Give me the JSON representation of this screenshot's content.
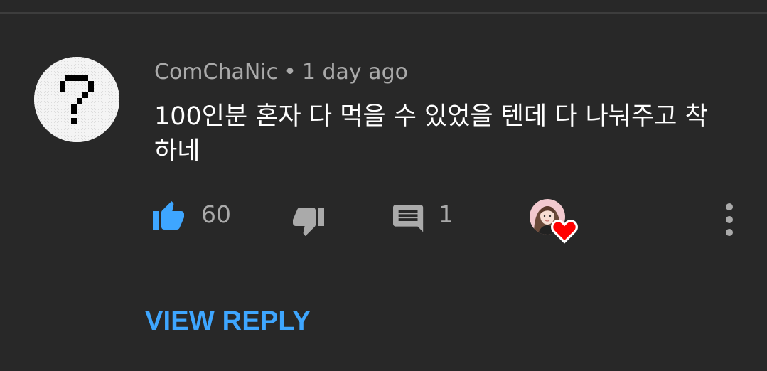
{
  "comment": {
    "author": "ComChaNic",
    "separator": "•",
    "timestamp": "1 day ago",
    "text": "100인분 혼자 다 먹을 수 있었을 텐데 다 나눠주고 착하네",
    "avatar_icon": "question-mark-icon"
  },
  "actions": {
    "like_icon": "thumbs-up-icon",
    "like_count": "60",
    "like_color": "#3ea6ff",
    "dislike_icon": "thumbs-down-icon",
    "reply_icon": "comment-icon",
    "reply_count": "1",
    "creator_heart_icon": "heart-icon",
    "heart_color": "#ff0000",
    "more_icon": "more-vertical-icon"
  },
  "view_reply": {
    "label": "VIEW REPLY",
    "color": "#3ea6ff"
  },
  "colors": {
    "background": "#282828",
    "muted_text": "#aaaaaa",
    "primary_text": "#ffffff"
  }
}
